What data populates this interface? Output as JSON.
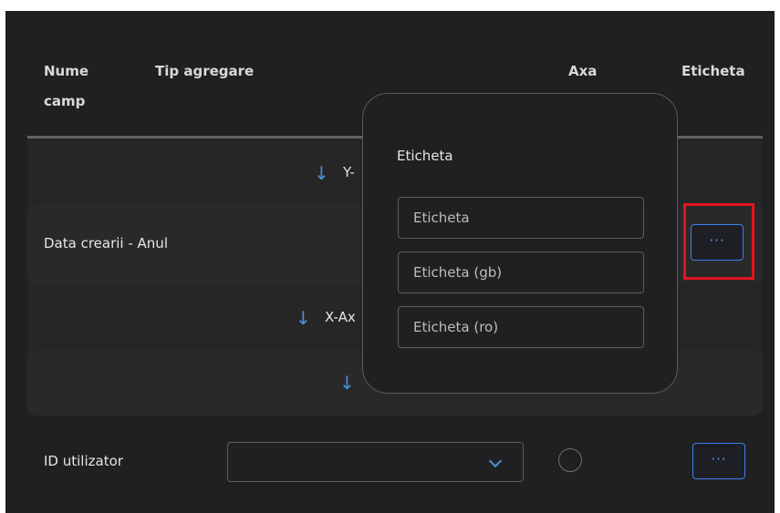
{
  "header": {
    "col_name_line1": "Nume",
    "col_name_line2": "camp",
    "col_aggregation": "Tip agregare",
    "col_axis": "Axa",
    "col_label": "Eticheta"
  },
  "rows": {
    "date_row_label": "Data crearii - Anul",
    "y_axis_text": "Y-",
    "x_axis_text": "X-Ax",
    "user_row_label": "ID utilizator",
    "more_button_label": "···"
  },
  "popover": {
    "title": "Eticheta",
    "inputs": [
      {
        "placeholder": "Eticheta"
      },
      {
        "placeholder": "Eticheta (gb)"
      },
      {
        "placeholder": "Eticheta (ro)"
      }
    ]
  },
  "icons": {
    "arrow_down": "arrow-down-icon",
    "chevron_down": "chevron-down-icon",
    "radio": "radio-icon"
  },
  "colors": {
    "accent": "#4a90e2",
    "highlight": "#e0141e",
    "background": "#202020"
  }
}
